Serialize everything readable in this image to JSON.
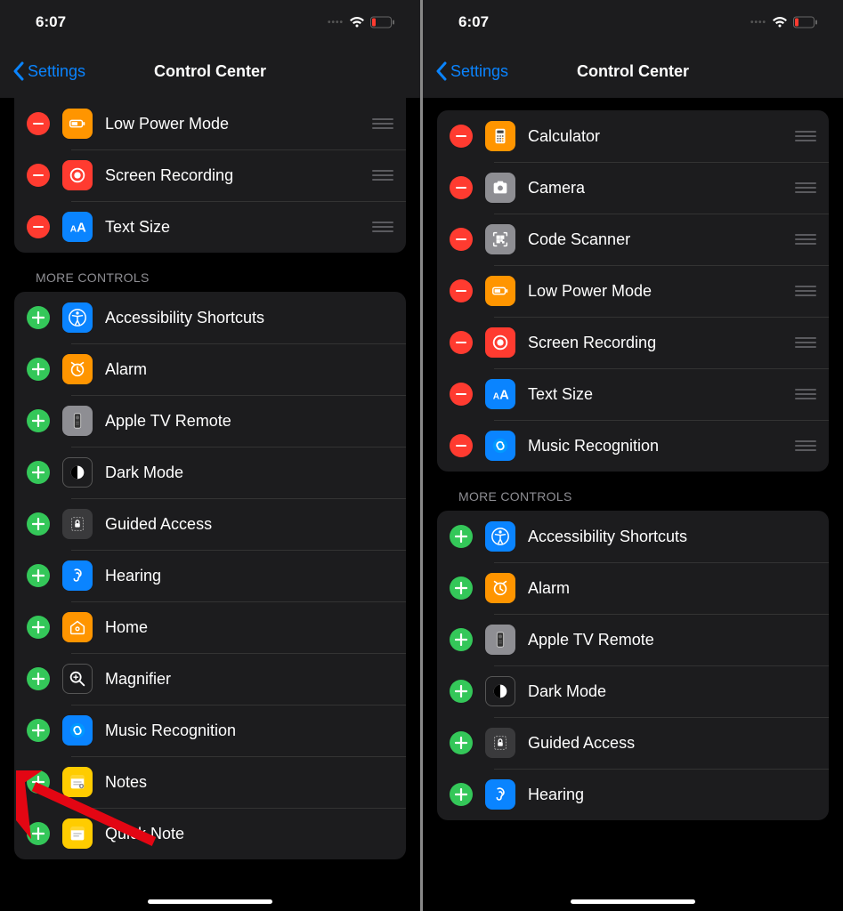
{
  "left": {
    "statusTime": "6:07",
    "back": "Settings",
    "title": "Control Center",
    "includedTop": [
      {
        "label": "Low Power Mode",
        "icon": "battery",
        "color": "#ff9500"
      },
      {
        "label": "Screen Recording",
        "icon": "record",
        "color": "#ff3b30"
      },
      {
        "label": "Text Size",
        "icon": "textsize",
        "color": "#0a84ff"
      }
    ],
    "moreLabel": "MORE CONTROLS",
    "more": [
      {
        "label": "Accessibility Shortcuts",
        "icon": "accessibility",
        "color": "#0a84ff"
      },
      {
        "label": "Alarm",
        "icon": "alarm",
        "color": "#ff9500"
      },
      {
        "label": "Apple TV Remote",
        "icon": "tvremote",
        "color": "#8e8e93"
      },
      {
        "label": "Dark Mode",
        "icon": "darkmode",
        "color": "#000000"
      },
      {
        "label": "Guided Access",
        "icon": "guided",
        "color": "#3a3a3c"
      },
      {
        "label": "Hearing",
        "icon": "hearing",
        "color": "#0a84ff"
      },
      {
        "label": "Home",
        "icon": "home",
        "color": "#ff9500"
      },
      {
        "label": "Magnifier",
        "icon": "magnifier",
        "color": "#000000"
      },
      {
        "label": "Music Recognition",
        "icon": "shazam",
        "color": "#0a84ff"
      },
      {
        "label": "Notes",
        "icon": "notes",
        "color": "#ffcc00"
      },
      {
        "label": "Quick Note",
        "icon": "quicknote",
        "color": "#ffcc00"
      }
    ]
  },
  "right": {
    "statusTime": "6:07",
    "back": "Settings",
    "title": "Control Center",
    "included": [
      {
        "label": "Calculator",
        "icon": "calculator",
        "color": "#ff9500"
      },
      {
        "label": "Camera",
        "icon": "camera",
        "color": "#8e8e93"
      },
      {
        "label": "Code Scanner",
        "icon": "qr",
        "color": "#8e8e93"
      },
      {
        "label": "Low Power Mode",
        "icon": "battery",
        "color": "#ff9500"
      },
      {
        "label": "Screen Recording",
        "icon": "record",
        "color": "#ff3b30"
      },
      {
        "label": "Text Size",
        "icon": "textsize",
        "color": "#0a84ff"
      },
      {
        "label": "Music Recognition",
        "icon": "shazam",
        "color": "#0a84ff"
      }
    ],
    "moreLabel": "MORE CONTROLS",
    "more": [
      {
        "label": "Accessibility Shortcuts",
        "icon": "accessibility",
        "color": "#0a84ff"
      },
      {
        "label": "Alarm",
        "icon": "alarm",
        "color": "#ff9500"
      },
      {
        "label": "Apple TV Remote",
        "icon": "tvremote",
        "color": "#8e8e93"
      },
      {
        "label": "Dark Mode",
        "icon": "darkmode",
        "color": "#000000"
      },
      {
        "label": "Guided Access",
        "icon": "guided",
        "color": "#3a3a3c"
      },
      {
        "label": "Hearing",
        "icon": "hearing",
        "color": "#0a84ff"
      }
    ]
  }
}
